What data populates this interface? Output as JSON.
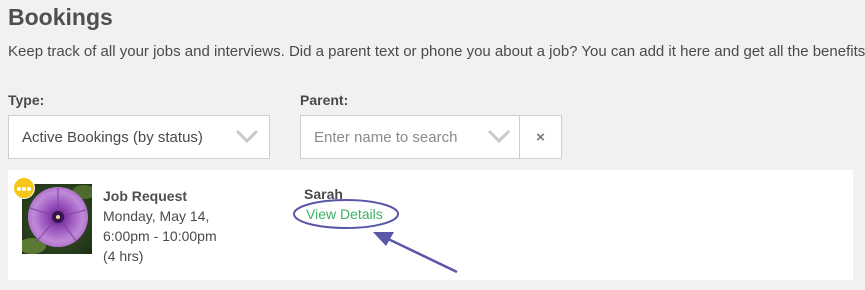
{
  "header": {
    "title": "Bookings",
    "subtitle": "Keep track of all your jobs and interviews. Did a parent text or phone you about a job? You can add it here and get all the benefits o"
  },
  "filters": {
    "type": {
      "label": "Type:",
      "selected": "Active Bookings (by status)",
      "icon": "chevron-down-icon"
    },
    "parent": {
      "label": "Parent:",
      "placeholder": "Enter name to search",
      "icon": "chevron-down-icon",
      "clear_label": "×"
    }
  },
  "booking": {
    "more_icon": "more-dots-icon",
    "type": "Job Request",
    "date": "Monday, May 14,",
    "time": "6:00pm - 10:00pm",
    "duration": "(4 hrs)",
    "parent_name": "Sarah",
    "view_details_label": "View Details"
  },
  "colors": {
    "background": "#f2f1ef",
    "link": "#3cb063",
    "badge": "#f5c518",
    "annotation": "#5a56a8"
  }
}
